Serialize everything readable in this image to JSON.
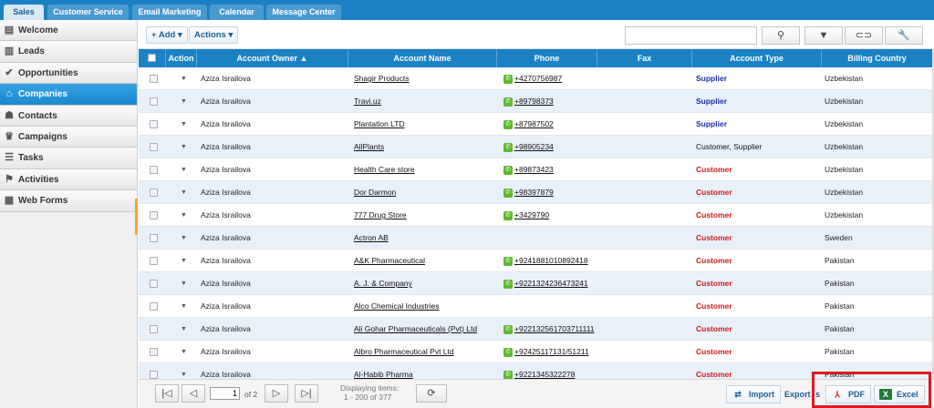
{
  "tabs": [
    {
      "label": "Sales"
    },
    {
      "label": "Customer Service"
    },
    {
      "label": "Email Marketing"
    },
    {
      "label": "Calendar"
    },
    {
      "label": "Message Center"
    }
  ],
  "sidebar": {
    "items": [
      {
        "label": "Welcome",
        "icon": "welcome-icon"
      },
      {
        "label": "Leads",
        "icon": "leads-icon"
      },
      {
        "label": "Opportunities",
        "icon": "checkmark-icon"
      },
      {
        "label": "Companies",
        "icon": "home-icon"
      },
      {
        "label": "Contacts",
        "icon": "contacts-icon"
      },
      {
        "label": "Campaigns",
        "icon": "campaign-icon"
      },
      {
        "label": "Tasks",
        "icon": "tasks-icon"
      },
      {
        "label": "Activities",
        "icon": "activities-icon"
      },
      {
        "label": "Web Forms",
        "icon": "webforms-icon"
      }
    ]
  },
  "toolbar": {
    "add_label": "+ Add ▾",
    "actions_label": "Actions ▾",
    "search_placeholder": "",
    "search_icon": "⚲",
    "filter_icon": "▼",
    "link_icon": "⊂⊃",
    "settings_icon": "🔧"
  },
  "grid": {
    "columns": [
      "Action",
      "Account Owner ▲",
      "Account Name",
      "Phone",
      "Fax",
      "Account Type",
      "Billing Country"
    ],
    "rows": [
      {
        "owner": "Aziza Israilova",
        "name": "Shagir Products",
        "phone": "+4270756987",
        "fax": "",
        "type": "Supplier",
        "country": "Uzbekistan"
      },
      {
        "owner": "Aziza Israilova",
        "name": "Travi.uz",
        "phone": "+89798373",
        "fax": "",
        "type": "Supplier",
        "country": "Uzbekistan"
      },
      {
        "owner": "Aziza Israilova",
        "name": "Plantation LTD",
        "phone": "+87987502",
        "fax": "",
        "type": "Supplier",
        "country": "Uzbekistan"
      },
      {
        "owner": "Aziza Israilova",
        "name": "AllPlants",
        "phone": "+98905234",
        "fax": "",
        "type": "Customer, Supplier",
        "country": "Uzbekistan"
      },
      {
        "owner": "Aziza Israilova",
        "name": "Health Care store",
        "phone": "+89873423",
        "fax": "",
        "type": "Customer",
        "country": "Uzbekistan"
      },
      {
        "owner": "Aziza Israilova",
        "name": "Dor Darmon",
        "phone": "+98397879",
        "fax": "",
        "type": "Customer",
        "country": "Uzbekistan"
      },
      {
        "owner": "Aziza Israilova",
        "name": "777 Drug Store",
        "phone": "+3429790",
        "fax": "",
        "type": "Customer",
        "country": "Uzbekistan"
      },
      {
        "owner": "Aziza Israilova",
        "name": "Actron AB",
        "phone": "",
        "fax": "",
        "type": "Customer",
        "country": "Sweden"
      },
      {
        "owner": "Aziza Israilova",
        "name": "A&K Pharmaceutical",
        "phone": "+9241881010892418",
        "fax": "",
        "type": "Customer",
        "country": "Pakistan"
      },
      {
        "owner": "Aziza Israilova",
        "name": "A. J. & Company",
        "phone": "+9221324236473241",
        "fax": "",
        "type": "Customer",
        "country": "Pakistan"
      },
      {
        "owner": "Aziza Israilova",
        "name": "Alco Chemical Industries",
        "phone": "",
        "fax": "",
        "type": "Customer",
        "country": "Pakistan"
      },
      {
        "owner": "Aziza Israilova",
        "name": "Ali Gohar Pharmaceuticals (Pvt) Ltd",
        "phone": "+922132561703711111",
        "fax": "",
        "type": "Customer",
        "country": "Pakistan"
      },
      {
        "owner": "Aziza Israilova",
        "name": "Albro Pharmaceutical Pvt Ltd",
        "phone": "+92425117131/51211",
        "fax": "",
        "type": "Customer",
        "country": "Pakistan"
      },
      {
        "owner": "Aziza Israilova",
        "name": "Al-Habib Pharma",
        "phone": "+9221345322278",
        "fax": "",
        "type": "Customer",
        "country": "Pakistan"
      }
    ]
  },
  "footer": {
    "first_icon": "|◁",
    "prev_icon": "◁",
    "page_value": "1",
    "page_of": "of 2",
    "next_icon": "▷",
    "last_icon": "▷|",
    "displaying_line1": "Displaying items:",
    "displaying_line2": "1 - 200 of 377",
    "refresh_icon": "⟳",
    "import_label": "Import",
    "export_label": "Export",
    "export_suffix": "s",
    "pdf_label": "PDF",
    "excel_label": "Excel"
  },
  "colors": {
    "brand_blue": "#1a82c4",
    "supplier": "#1a2fa8",
    "customer": "#d11a1a",
    "highlight": "#e0181f"
  }
}
